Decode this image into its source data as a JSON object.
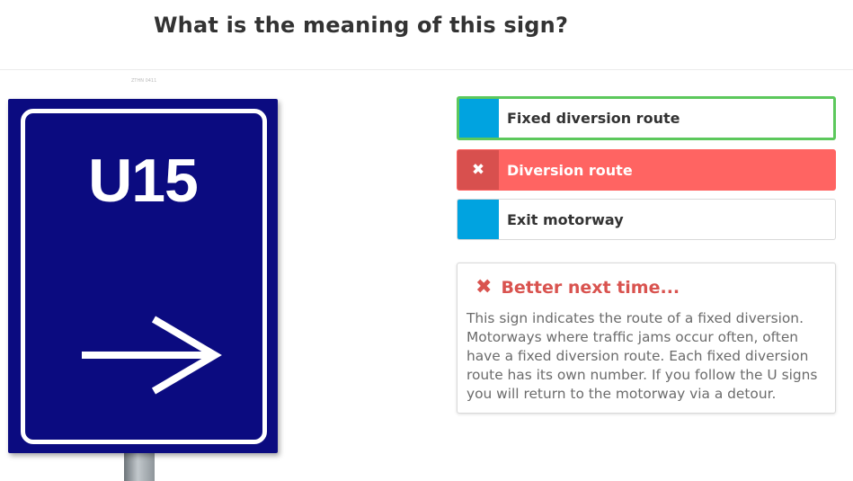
{
  "question": {
    "text": "What is the meaning of this sign?"
  },
  "image": {
    "caption": "ZTHN 0411",
    "sign_text": "U15",
    "sign_color": "#0b0b80"
  },
  "options": [
    {
      "label": "Fixed diversion route",
      "state": "correct",
      "accent": "#5cc85c"
    },
    {
      "label": "Diversion route",
      "state": "wrong-selected",
      "accent": "#ff6462",
      "icon": "x-icon"
    },
    {
      "label": "Exit motorway",
      "state": "default",
      "accent": "#00a3e0"
    }
  ],
  "feedback": {
    "icon": "x-icon",
    "title": "Better next time...",
    "color": "#d9534f",
    "text": "This sign indicates the route of a fixed diversion. Motorways where traffic jams occur often, often have a fixed diversion route. Each fixed diversion route has its own number. If you follow the U signs you will return to the motorway via a detour."
  }
}
